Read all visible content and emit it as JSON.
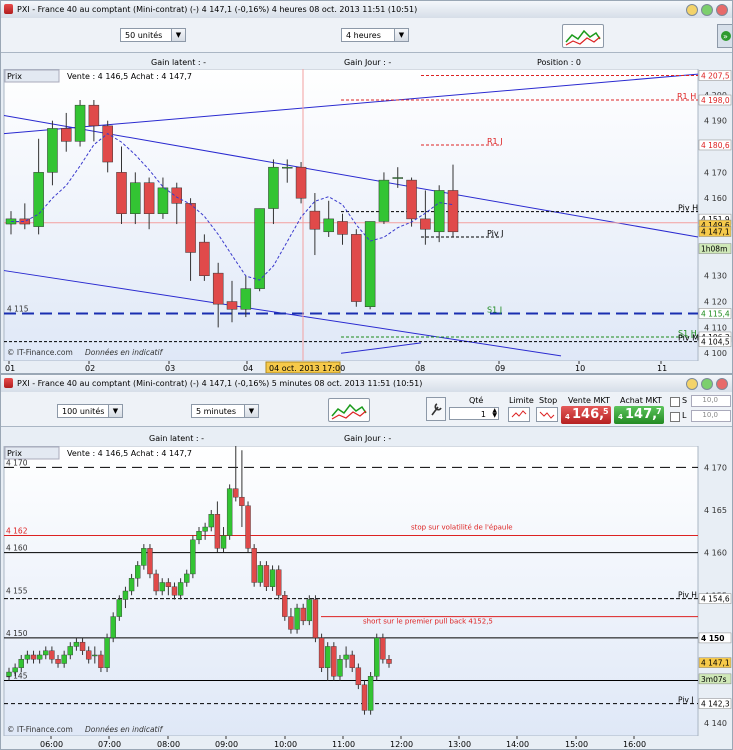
{
  "top": {
    "title": "PXI - France 40 au comptant (Mini-contrat)  (-)     4 147,1 (-0,16%)     4 heures   08 oct. 2013 11:51 (10:51)",
    "units_select": "50 unités",
    "period_select": "4 heures",
    "gain_latent": "Gain latent : -",
    "gain_jour": "Gain Jour : -",
    "position": "Position : 0",
    "legend_prix": "Prix",
    "legend_quote": "Vente : 4 146,5 Achat : 4 147,7",
    "credit": "© IT-Finance.com",
    "credit_note": "Données en indicatif",
    "crosshair_date": "04 oct. 2013 17:00",
    "x_labels": [
      "01",
      "02",
      "03",
      "04",
      "07",
      "08",
      "09",
      "10",
      "11"
    ],
    "y_labels": [
      "4 200",
      "4 190",
      "4 180",
      "4 170",
      "4 160",
      "4 150",
      "4 140",
      "4 130",
      "4 120",
      "4 110",
      "4 100"
    ],
    "left_price": "4 115",
    "levels": [
      {
        "label": "R1 H",
        "value": "4 198,0",
        "color": "#d22"
      },
      {
        "label": "R1 J",
        "value": "4 180,6",
        "color": "#d22"
      },
      {
        "label": "Piv H",
        "value": "4 154,8",
        "color": "#000"
      },
      {
        "label": "Piv J",
        "value": "",
        "color": "#000"
      },
      {
        "label": "S1 J",
        "value": "4 115,4",
        "color": "#1a8a1a"
      },
      {
        "label": "S1 H",
        "value": "4 106,3",
        "color": "#1a8a1a"
      },
      {
        "label": "Piv M",
        "value": "4 104,5",
        "color": "#000"
      }
    ],
    "price_tags": [
      {
        "value": "4 207,5",
        "bg": "#fff",
        "fg": "#d22"
      },
      {
        "value": "4 151,9",
        "bg": "#fff",
        "fg": "#000"
      },
      {
        "value": "4 149,6",
        "bg": "#f6c94a",
        "fg": "#000"
      },
      {
        "value": "4 147,1",
        "bg": "#f6c94a",
        "fg": "#000"
      },
      {
        "value": "1h08m",
        "bg": "#cfe8b8",
        "fg": "#000"
      }
    ],
    "chart_data": {
      "type": "candlestick",
      "x_axis": [
        "01",
        "02",
        "03",
        "04",
        "07",
        "08",
        "09",
        "10",
        "11"
      ],
      "ylim": [
        4097,
        4210
      ],
      "candles": [
        [
          4150,
          4155,
          4146,
          4152
        ],
        [
          4152,
          4158,
          4148,
          4150
        ],
        [
          4149,
          4183,
          4146,
          4170
        ],
        [
          4170,
          4190,
          4165,
          4187
        ],
        [
          4187,
          4193,
          4178,
          4182
        ],
        [
          4182,
          4198,
          4180,
          4196
        ],
        [
          4196,
          4198,
          4182,
          4188
        ],
        [
          4188,
          4190,
          4170,
          4174
        ],
        [
          4170,
          4180,
          4150,
          4154
        ],
        [
          4154,
          4170,
          4150,
          4166
        ],
        [
          4166,
          4168,
          4148,
          4154
        ],
        [
          4154,
          4168,
          4152,
          4164
        ],
        [
          4164,
          4166,
          4150,
          4158
        ],
        [
          4158,
          4160,
          4128,
          4139
        ],
        [
          4143,
          4146,
          4128,
          4130
        ],
        [
          4131,
          4135,
          4110,
          4119
        ],
        [
          4120,
          4128,
          4112,
          4117
        ],
        [
          4117,
          4130,
          4114,
          4125
        ],
        [
          4125,
          4156,
          4124,
          4156
        ],
        [
          4156,
          4175,
          4150,
          4172
        ],
        [
          4172,
          4175,
          4166,
          4172
        ],
        [
          4172,
          4174,
          4158,
          4160
        ],
        [
          4155,
          4162,
          4138,
          4148
        ],
        [
          4147,
          4159,
          4145,
          4152
        ],
        [
          4151,
          4154,
          4142,
          4146
        ],
        [
          4146,
          4148,
          4118,
          4120
        ],
        [
          4118,
          4150,
          4117,
          4151
        ],
        [
          4151,
          4170,
          4150,
          4167
        ],
        [
          4168,
          4172,
          4164,
          4168
        ],
        [
          4167,
          4168,
          4149,
          4152
        ],
        [
          4152,
          4163,
          4142,
          4148
        ],
        [
          4147,
          4165,
          4143,
          4163
        ],
        [
          4163,
          4173,
          4145,
          4147
        ]
      ]
    }
  },
  "bottom": {
    "title": "PXI - France 40 au comptant (Mini-contrat)  (-)     4 147,1 (-0,16%)     5 minutes   08 oct. 2013 11:51 (10:51)",
    "units_select": "100 unités",
    "period_select": "5 minutes",
    "qty_label": "Qté",
    "qty_value": "1",
    "limite_label": "Limite",
    "stop_label": "Stop",
    "sell_label": "Vente MKT",
    "sell_price_prefix": "4",
    "sell_price": "146,",
    "sell_price_suffix": "5",
    "buy_label": "Achat MKT",
    "buy_price_prefix": "4",
    "buy_price": "147,",
    "buy_price_suffix": "7",
    "s_label": "S",
    "l_label": "L",
    "s_value": "10,0",
    "l_value": "10,0",
    "gain_latent": "Gain latent : -",
    "gain_jour": "Gain Jour : -",
    "legend_prix": "Prix",
    "legend_quote": "Vente : 4 146,5 Achat : 4 147,7",
    "credit": "© IT-Finance.com",
    "credit_note": "Données en indicatif",
    "x_labels": [
      "06:00",
      "07:00",
      "08:00",
      "09:00",
      "10:00",
      "11:00",
      "12:00",
      "13:00",
      "14:00",
      "15:00",
      "16:00"
    ],
    "y_labels": [
      "4 170",
      "4 165",
      "4 160",
      "4 155",
      "4 150",
      "4 145",
      "4 140"
    ],
    "left_labels": [
      "4 170",
      "4 162",
      "4 160",
      "4 155",
      "4 150",
      "4 145"
    ],
    "annotation_1": "stop sur volatilité de l'épaule",
    "annotation_2": "short sur le premier pull back 4152,5",
    "piv_h": "Piv H",
    "piv_j": "Piv J",
    "price_tags": [
      {
        "value": "4 154,6",
        "bg": "#fff",
        "fg": "#000"
      },
      {
        "value": "4 150",
        "bg": "#fff",
        "fg": "#000"
      },
      {
        "value": "4 147,1",
        "bg": "#f6c94a",
        "fg": "#000"
      },
      {
        "value": "3m07s",
        "bg": "#cfe8b8",
        "fg": "#000"
      },
      {
        "value": "4 142,3",
        "bg": "#fff",
        "fg": "#000"
      }
    ],
    "chart_data": {
      "type": "candlestick",
      "x_axis": [
        "06:00",
        "07:00",
        "08:00",
        "09:00",
        "10:00",
        "11:00",
        "12:00",
        "13:00",
        "14:00",
        "15:00",
        "16:00"
      ],
      "ylim": [
        4138.5,
        4172.5
      ],
      "candles": [
        [
          4145.5,
          4146.5,
          4145,
          4146
        ],
        [
          4146,
          4147,
          4145.5,
          4146.5
        ],
        [
          4146.5,
          4148,
          4146,
          4147.5
        ],
        [
          4147.5,
          4148.5,
          4147,
          4148
        ],
        [
          4148,
          4148.5,
          4147,
          4147.5
        ],
        [
          4147.5,
          4148.5,
          4147,
          4148
        ],
        [
          4148,
          4149,
          4147.5,
          4148.5
        ],
        [
          4148.5,
          4149,
          4147,
          4147.5
        ],
        [
          4147.5,
          4148,
          4146.5,
          4147
        ],
        [
          4147,
          4148.5,
          4146.5,
          4148
        ],
        [
          4148,
          4149.5,
          4147.5,
          4149
        ],
        [
          4149,
          4150,
          4148.5,
          4149.5
        ],
        [
          4149.5,
          4150,
          4148,
          4148.5
        ],
        [
          4148.5,
          4149,
          4147,
          4147.5
        ],
        [
          4148,
          4149,
          4147,
          4148
        ],
        [
          4148,
          4148.5,
          4146,
          4146.5
        ],
        [
          4146.5,
          4150.5,
          4146,
          4150
        ],
        [
          4150,
          4153,
          4149.5,
          4152.5
        ],
        [
          4152.5,
          4155,
          4152,
          4154.5
        ],
        [
          4154.5,
          4156,
          4153.5,
          4155.5
        ],
        [
          4155.5,
          4157.5,
          4155,
          4157
        ],
        [
          4157,
          4159,
          4156,
          4158.5
        ],
        [
          4158.5,
          4161,
          4158,
          4160.5
        ],
        [
          4160.5,
          4161,
          4157,
          4157.5
        ],
        [
          4157.5,
          4158,
          4155,
          4155.5
        ],
        [
          4155.5,
          4157,
          4155,
          4156.5
        ],
        [
          4156.5,
          4157,
          4155,
          4156
        ],
        [
          4156,
          4156.5,
          4154.5,
          4155
        ],
        [
          4155,
          4157,
          4154.5,
          4156.5
        ],
        [
          4156.5,
          4158,
          4156,
          4157.5
        ],
        [
          4157.5,
          4162,
          4157,
          4161.5
        ],
        [
          4161.5,
          4163,
          4161,
          4162.5
        ],
        [
          4162.5,
          4163.5,
          4161.5,
          4163
        ],
        [
          4163,
          4165,
          4162.5,
          4164.5
        ],
        [
          4164.5,
          4166,
          4160,
          4160.5
        ],
        [
          4160.5,
          4163,
          4160,
          4162
        ],
        [
          4162,
          4168,
          4161.5,
          4167.5
        ],
        [
          4167.5,
          4173,
          4166,
          4166.5
        ],
        [
          4166.5,
          4172,
          4163,
          4165.5
        ],
        [
          4165.5,
          4166,
          4160,
          4160.5
        ],
        [
          4160.5,
          4161,
          4156,
          4156.5
        ],
        [
          4156.5,
          4159,
          4156,
          4158.5
        ],
        [
          4158.5,
          4159,
          4155.5,
          4156
        ],
        [
          4156,
          4158.5,
          4155.5,
          4158
        ],
        [
          4158,
          4158.5,
          4154.5,
          4155
        ],
        [
          4155,
          4155.5,
          4152,
          4152.5
        ],
        [
          4152.5,
          4153.5,
          4150.5,
          4151
        ],
        [
          4151,
          4154,
          4150.5,
          4153.5
        ],
        [
          4153.5,
          4154,
          4151.5,
          4152
        ],
        [
          4152,
          4155,
          4151.5,
          4154.5
        ],
        [
          4154.5,
          4155,
          4149.5,
          4150
        ],
        [
          4150,
          4150.5,
          4146,
          4146.5
        ],
        [
          4146.5,
          4149.5,
          4145,
          4149
        ],
        [
          4149,
          4149.5,
          4145,
          4145.5
        ],
        [
          4145.5,
          4148,
          4145,
          4147.5
        ],
        [
          4147.5,
          4149,
          4146.5,
          4148
        ],
        [
          4148,
          4148.5,
          4146,
          4146.5
        ],
        [
          4146.5,
          4147,
          4144,
          4144.5
        ],
        [
          4144.5,
          4145,
          4141,
          4141.5
        ],
        [
          4141.5,
          4146,
          4141,
          4145.5
        ],
        [
          4145.5,
          4150.5,
          4145,
          4150
        ],
        [
          4150,
          4150.5,
          4147,
          4147.5
        ],
        [
          4147.5,
          4148,
          4146.5,
          4147
        ]
      ]
    }
  }
}
